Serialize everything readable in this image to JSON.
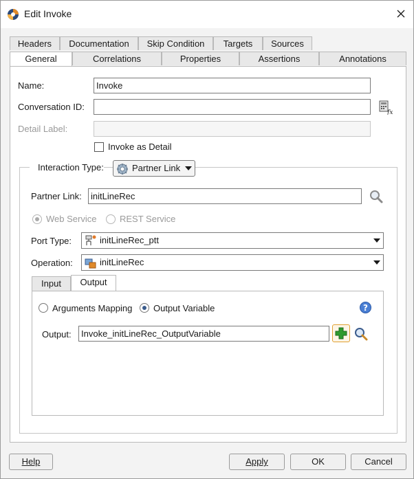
{
  "window": {
    "title": "Edit Invoke"
  },
  "tabs_row1": [
    "Headers",
    "Documentation",
    "Skip Condition",
    "Targets",
    "Sources"
  ],
  "tabs_row2": [
    "General",
    "Correlations",
    "Properties",
    "Assertions",
    "Annotations"
  ],
  "general": {
    "name_label": "Name:",
    "name_value": "Invoke",
    "conversation_label": "Conversation ID:",
    "conversation_value": "",
    "detail_label": "Detail Label:",
    "detail_value": "",
    "invoke_as_detail_label": "Invoke as Detail",
    "interaction_type_label": "Interaction Type:",
    "interaction_type_value": "Partner Link",
    "partner_link_label": "Partner Link:",
    "partner_link_value": "initLineRec",
    "web_service_label": "Web Service",
    "rest_service_label": "REST Service",
    "port_type_label": "Port Type:",
    "port_type_value": "initLineRec_ptt",
    "operation_label": "Operation:",
    "operation_value": "initLineRec"
  },
  "inner_tabs": [
    "Input",
    "Output"
  ],
  "output_panel": {
    "arguments_mapping_label": "Arguments Mapping",
    "output_variable_label": "Output Variable",
    "output_label": "Output:",
    "output_value": "Invoke_initLineRec_OutputVariable"
  },
  "footer": {
    "help_label": "Help",
    "apply_label": "Apply",
    "ok_label": "OK",
    "cancel_label": "Cancel"
  },
  "icons": {
    "title": "oracle-bpel-icon",
    "close": "close-icon",
    "expression_builder": "expression-builder-icon",
    "partner_link": "partner-link-icon",
    "search": "search-icon",
    "port_type": "port-type-icon",
    "operation": "operation-icon",
    "help": "help-icon",
    "add": "add-icon"
  },
  "colors": {
    "accent": "#3a5b8c",
    "add_icon_green": "#2e9a2e",
    "add_button_border": "#e0a030",
    "help_blue": "#4a7fd4"
  }
}
